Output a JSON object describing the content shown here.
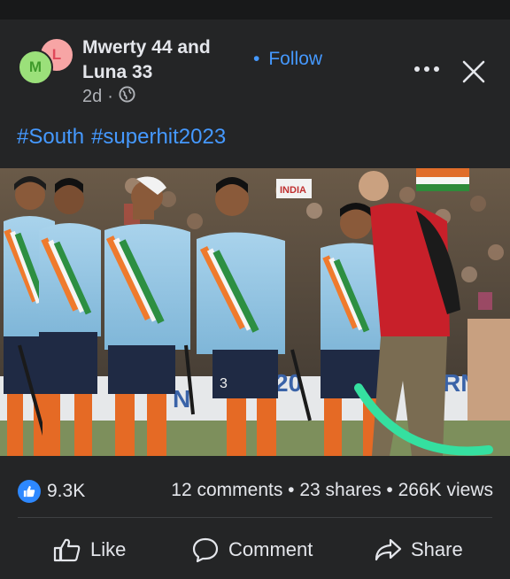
{
  "post": {
    "avatar_primary_initial": "M",
    "avatar_secondary_initial": "L",
    "author_line1": "Mwerty 44 and",
    "author_line2": "Luna 33",
    "follow_dot": "•",
    "follow_label": "Follow",
    "time": "2d",
    "time_sep": "·",
    "privacy_icon": "globe-icon",
    "hashtags": [
      "#South",
      "#superhit2023"
    ]
  },
  "photo": {
    "description_icon": "photo",
    "jersey_number": "3",
    "banner_text_left": "N",
    "banner_text_mid": "20",
    "banner_text_right": "RN",
    "sign_text": "INDIA"
  },
  "stats": {
    "reactions": "9.3K",
    "summary": "12 comments • 23 shares • 266K views"
  },
  "actions": {
    "like": "Like",
    "comment": "Comment",
    "share": "Share"
  },
  "colors": {
    "background": "#242526",
    "accent": "#4599ff",
    "like_blue": "#2d88ff",
    "highlight_stroke": "#35e0a0"
  }
}
